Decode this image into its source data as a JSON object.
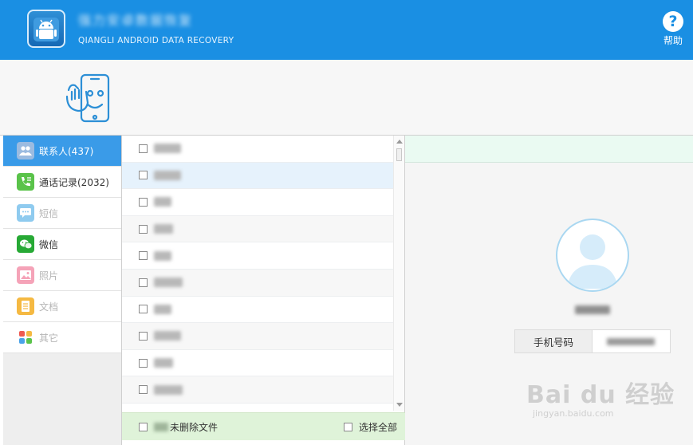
{
  "header": {
    "app_title": "强力安卓数据恢复",
    "app_subtitle": "QIANGLI ANDROID DATA RECOVERY",
    "help_label": "帮助",
    "help_icon": "?"
  },
  "sidebar": {
    "items": [
      {
        "label": "联系人(437)",
        "icon": "contacts-icon",
        "color": "#8fb3d9",
        "active": true
      },
      {
        "label": "通话记录(2032)",
        "icon": "call-log-icon",
        "color": "#5ac34a"
      },
      {
        "label": "短信",
        "icon": "sms-icon",
        "color": "#8fcbef",
        "disabled": true
      },
      {
        "label": "微信",
        "icon": "wechat-icon",
        "color": "#27a935"
      },
      {
        "label": "照片",
        "icon": "photo-icon",
        "color": "#f5a3b8",
        "disabled": true
      },
      {
        "label": "文档",
        "icon": "document-icon",
        "color": "#f5b942",
        "disabled": true
      },
      {
        "label": "其它",
        "icon": "other-icon",
        "color": "#f0a830",
        "disabled": true
      }
    ]
  },
  "contacts": {
    "rows": [
      "",
      "",
      "",
      "",
      "",
      "",
      "",
      "",
      "",
      ""
    ]
  },
  "list_footer": {
    "undeleted_label": "未删除文件",
    "select_all_label": "选择全部"
  },
  "detail": {
    "phone_label": "手机号码"
  },
  "watermark": {
    "main": "Bai du 经验",
    "sub": "jingyan.baidu.com"
  },
  "colors": {
    "header": "#1a8fe3",
    "active_item": "#3a9be8",
    "selected_row": "#e6f2fc",
    "footer_bg": "#dff3d9"
  }
}
